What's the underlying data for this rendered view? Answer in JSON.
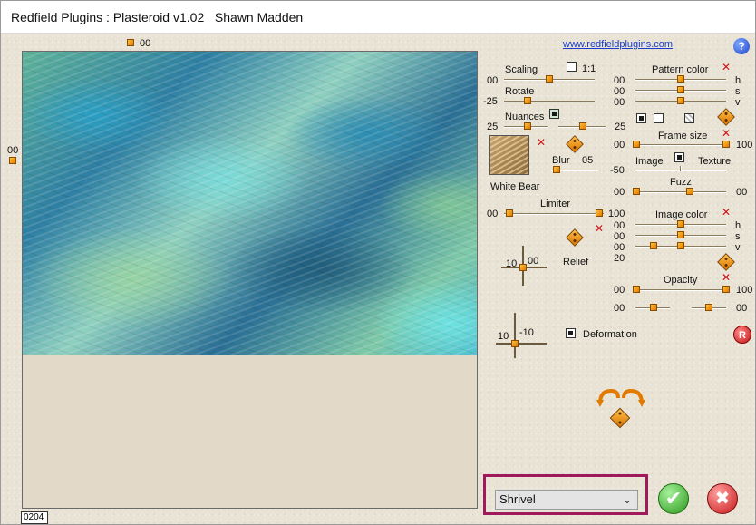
{
  "window": {
    "title": "Redfield Plugins : Plasteroid v1.02   Shawn Madden"
  },
  "link": "www.redfieldplugins.com",
  "help_label": "?",
  "reset_label": "R",
  "preview": {
    "top_value": "00",
    "left_value": "00",
    "counter": "0204"
  },
  "scaling": {
    "label": "Scaling",
    "ratio_label": "1:1",
    "value": "00"
  },
  "rotate": {
    "label": "Rotate",
    "value": "-25"
  },
  "nuances": {
    "label": "Nuances",
    "value_left": "25",
    "value_right": "25"
  },
  "texture": {
    "name": "White Bear"
  },
  "blur": {
    "label": "Blur",
    "value": "05"
  },
  "limiter": {
    "label": "Limiter",
    "value_left": "00",
    "value_right": "100"
  },
  "relief": {
    "label": "Relief",
    "x": "10",
    "y": "00"
  },
  "deformation": {
    "label": "Deformation",
    "x": "10",
    "y": "-10"
  },
  "pattern_color": {
    "label": "Pattern color",
    "h": "00",
    "s": "00",
    "v": "00",
    "h_label": "h",
    "s_label": "s",
    "v_label": "v"
  },
  "frame_size": {
    "label": "Frame size",
    "value_left": "00",
    "value_right": "100"
  },
  "image_texture": {
    "image_label": "Image",
    "texture_label": "Texture",
    "value": "-50"
  },
  "fuzz": {
    "label": "Fuzz",
    "value_left": "00",
    "value_right": "00"
  },
  "image_color": {
    "label": "Image color",
    "h": "00",
    "s": "00",
    "v": "00",
    "extra": "20",
    "h_label": "h",
    "s_label": "s",
    "v_label": "v"
  },
  "opacity": {
    "label": "Opacity",
    "value_left": "00",
    "value_right": "100",
    "row2_left": "00",
    "row2_right": "00"
  },
  "mode_select": {
    "selected": "Shrivel"
  },
  "ok_label": "✔",
  "cancel_label": "✖"
}
